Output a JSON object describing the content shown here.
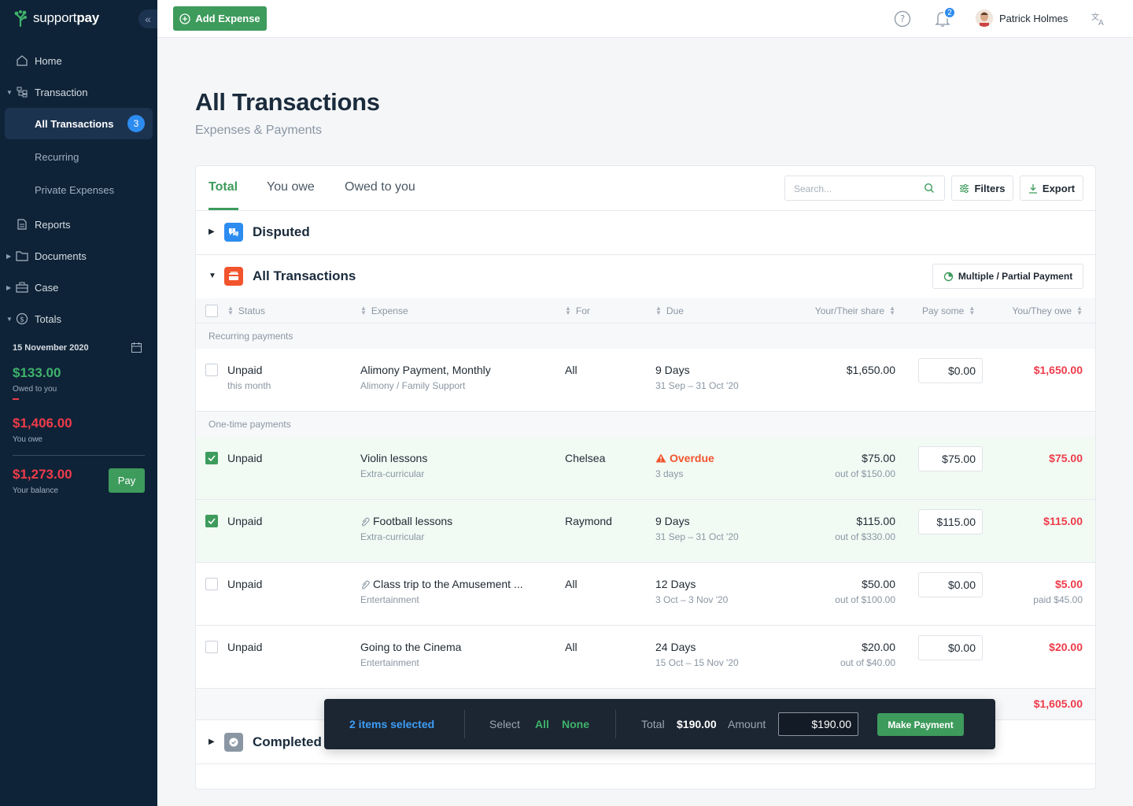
{
  "app": {
    "brand_light": "support",
    "brand_bold": "pay"
  },
  "sidebar": {
    "items": [
      {
        "label": "Home"
      },
      {
        "label": "Transaction"
      },
      {
        "label": "All Transactions",
        "badge": "3"
      },
      {
        "label": "Recurring"
      },
      {
        "label": "Private Expenses"
      },
      {
        "label": "Reports"
      },
      {
        "label": "Documents"
      },
      {
        "label": "Case"
      },
      {
        "label": "Totals"
      }
    ],
    "totals": {
      "date": "15 November 2020",
      "owed_to_you": "$133.00",
      "owed_to_you_label": "Owed to you",
      "you_owe": "$1,406.00",
      "you_owe_label": "You owe",
      "balance": "$1,273.00",
      "balance_label": "Your balance",
      "pay_label": "Pay"
    }
  },
  "header": {
    "add_expense_label": "Add Expense",
    "notification_count": "2",
    "user_name": "Patrick Holmes"
  },
  "page": {
    "title": "All Transactions",
    "subtitle": "Expenses & Payments"
  },
  "tabs": [
    {
      "label": "Total"
    },
    {
      "label": "You owe"
    },
    {
      "label": "Owed to you"
    }
  ],
  "search": {
    "placeholder": "Search..."
  },
  "toolbar": {
    "filters_label": "Filters",
    "export_label": "Export"
  },
  "sections": {
    "disputed": "Disputed",
    "all_transactions": "All Transactions",
    "completed": "Completed p",
    "multi_payment_label": "Multiple / Partial Payment"
  },
  "columns": [
    "Status",
    "Expense",
    "For",
    "Due",
    "Your/Their share",
    "Pay some",
    "You/They owe"
  ],
  "groups": {
    "recurring": "Recurring payments",
    "one_time": "One-time payments"
  },
  "rows": [
    {
      "status": "Unpaid",
      "status_sub": "this month",
      "expense": "Alimony Payment, Monthly",
      "category": "Alimony / Family Support",
      "for": "All",
      "due": "9 Days",
      "due_sub": "31 Sep – 31 Oct '20",
      "share": "$1,650.00",
      "share_sub": "",
      "pay": "$0.00",
      "owe": "$1,650.00",
      "owe_sub": ""
    },
    {
      "status": "Unpaid",
      "status_sub": "",
      "expense": "Violin lessons",
      "category": "Extra-curricular",
      "for": "Chelsea",
      "due": "Overdue",
      "due_sub": "3 days",
      "share": "$75.00",
      "share_sub": "out of $150.00",
      "pay": "$75.00",
      "owe": "$75.00",
      "owe_sub": ""
    },
    {
      "status": "Unpaid",
      "status_sub": "",
      "expense": "Football lessons",
      "category": "Extra-curricular",
      "for": "Raymond",
      "due": "9 Days",
      "due_sub": "31 Sep – 31 Oct '20",
      "share": "$115.00",
      "share_sub": "out of $330.00",
      "pay": "$115.00",
      "owe": "$115.00",
      "owe_sub": ""
    },
    {
      "status": "Unpaid",
      "status_sub": "",
      "expense": "Class trip to the Amusement ...",
      "category": "Entertainment",
      "for": "All",
      "due": "12 Days",
      "due_sub": "3 Oct – 3 Nov '20",
      "share": "$50.00",
      "share_sub": "out of $100.00",
      "pay": "$0.00",
      "owe": "$5.00",
      "owe_sub": "paid $45.00"
    },
    {
      "status": "Unpaid",
      "status_sub": "",
      "expense": "Going to the Cinema",
      "category": "Entertainment",
      "for": "All",
      "due": "24 Days",
      "due_sub": "15 Oct – 15 Nov '20",
      "share": "$20.00",
      "share_sub": "out of $40.00",
      "pay": "$0.00",
      "owe": "$20.00",
      "owe_sub": ""
    }
  ],
  "total_owe": "$1,605.00",
  "selection_bar": {
    "count_label": "2 items selected",
    "select_label": "Select",
    "all_label": "All",
    "none_label": "None",
    "total_label": "Total",
    "total_value": "$190.00",
    "amount_label": "Amount",
    "amount_value": "$190.00",
    "make_payment_label": "Make Payment"
  },
  "colors": {
    "sidebar_bg": "#0e2337",
    "accent_green": "#3d9b5c",
    "owe_red": "#ef3b4a",
    "badge_blue": "#2d8cf0",
    "overdue_orange": "#f2542d"
  }
}
